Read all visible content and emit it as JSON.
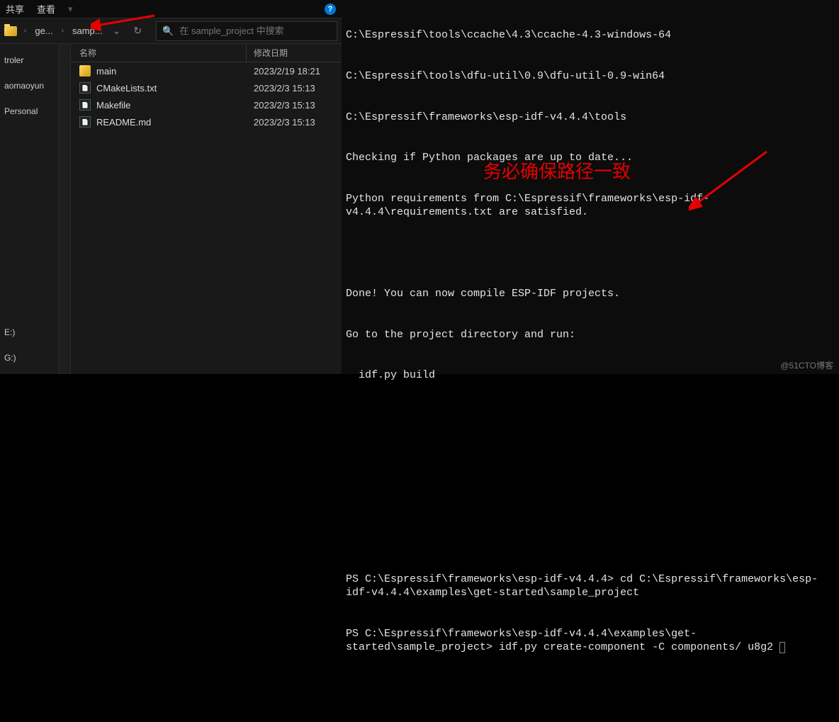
{
  "explorer": {
    "menu": {
      "share": "共享",
      "view": "查看"
    },
    "breadcrumb": {
      "part1": "ge...",
      "part2": "samp..."
    },
    "search": {
      "placeholder": "在 sample_project 中搜索"
    },
    "nav_items": [
      "troler",
      "aomaoyun",
      "Personal",
      "E:)",
      "G:)"
    ],
    "headers": {
      "name": "名称",
      "date": "修改日期"
    },
    "files": [
      {
        "name": "main",
        "date": "2023/2/19 18:21",
        "type": "folder"
      },
      {
        "name": "CMakeLists.txt",
        "date": "2023/2/3 15:13",
        "type": "txt"
      },
      {
        "name": "Makefile",
        "date": "2023/2/3 15:13",
        "type": "txt"
      },
      {
        "name": "README.md",
        "date": "2023/2/3 15:13",
        "type": "txt"
      }
    ]
  },
  "terminal": {
    "lines": [
      "C:\\Espressif\\tools\\ccache\\4.3\\ccache-4.3-windows-64",
      "C:\\Espressif\\tools\\dfu-util\\0.9\\dfu-util-0.9-win64",
      "C:\\Espressif\\frameworks\\esp-idf-v4.4.4\\tools",
      "Checking if Python packages are up to date...",
      "Python requirements from C:\\Espressif\\frameworks\\esp-idf-v4.4.4\\requirements.txt are satisfied.",
      "",
      "Done! You can now compile ESP-IDF projects.",
      "Go to the project directory and run:",
      "  idf.py build",
      "",
      "",
      "",
      "",
      "PS C:\\Espressif\\frameworks\\esp-idf-v4.4.4> cd C:\\Espressif\\frameworks\\esp-idf-v4.4.4\\examples\\get-started\\sample_project",
      "PS C:\\Espressif\\frameworks\\esp-idf-v4.4.4\\examples\\get-started\\sample_project> idf.py create-component -C components/ u8g2"
    ],
    "annotation": "务必确保路径一致"
  },
  "watermark": "@51CTO博客"
}
